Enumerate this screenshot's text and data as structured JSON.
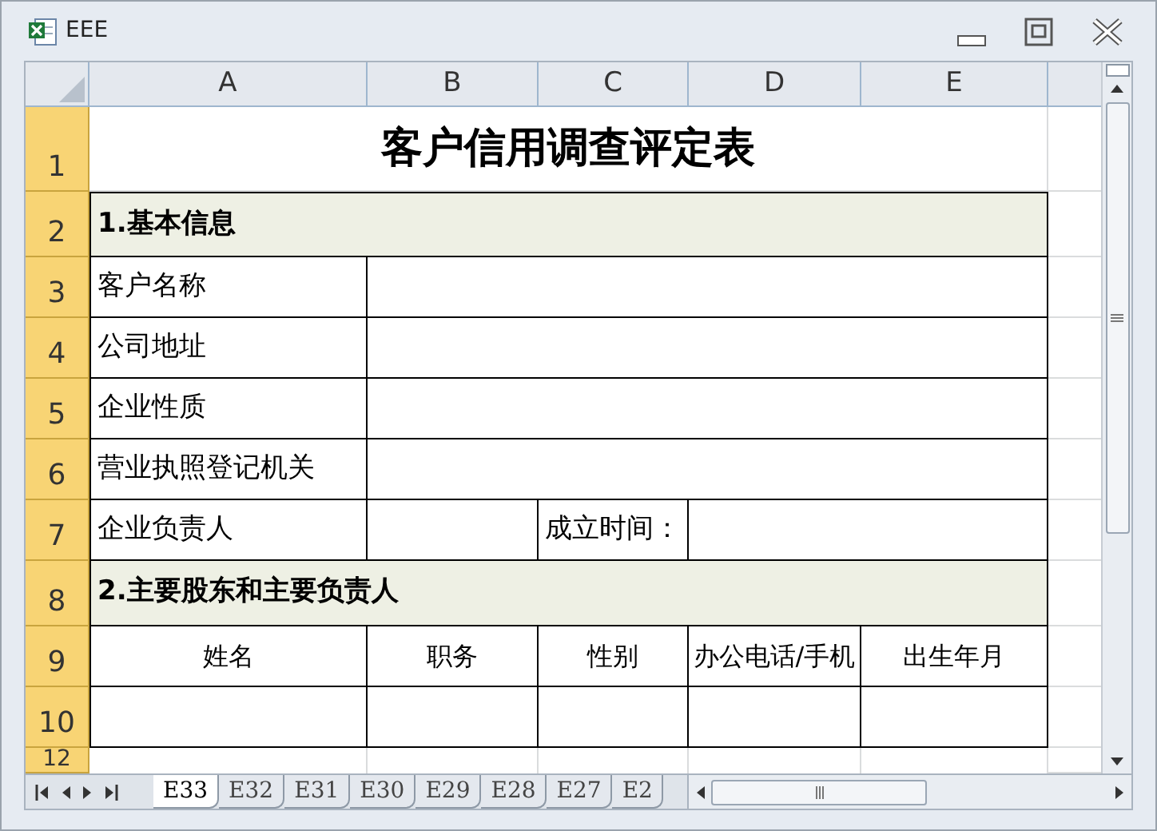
{
  "window": {
    "title": "EEE"
  },
  "columns": [
    "A",
    "B",
    "C",
    "D",
    "E"
  ],
  "rows": [
    {
      "number": "1",
      "kind": "title",
      "cells": [
        "客户信用调查评定表"
      ]
    },
    {
      "number": "2",
      "kind": "section",
      "cells": [
        "1.基本信息"
      ]
    },
    {
      "number": "3",
      "kind": "field",
      "cells": [
        "客户名称"
      ]
    },
    {
      "number": "4",
      "kind": "field",
      "cells": [
        "公司地址"
      ]
    },
    {
      "number": "5",
      "kind": "field",
      "cells": [
        "企业性质"
      ]
    },
    {
      "number": "6",
      "kind": "field",
      "cells": [
        "营业执照登记机关"
      ]
    },
    {
      "number": "7",
      "kind": "split",
      "cells": [
        "企业负责人",
        "成立时间："
      ]
    },
    {
      "number": "8",
      "kind": "section",
      "cells": [
        "2.主要股东和主要负责人"
      ]
    },
    {
      "number": "9",
      "kind": "header",
      "cells": [
        "姓名",
        "职务",
        "性别",
        "办公电话/手机",
        "出生年月"
      ]
    },
    {
      "number": "10",
      "kind": "blank",
      "cells": []
    },
    {
      "number": "12",
      "kind": "cut",
      "cells": []
    }
  ],
  "sheet_tabs": [
    {
      "label": "E33",
      "selected": true
    },
    {
      "label": "E32",
      "selected": false
    },
    {
      "label": "E31",
      "selected": false
    },
    {
      "label": "E30",
      "selected": false
    },
    {
      "label": "E29",
      "selected": false
    },
    {
      "label": "E28",
      "selected": false
    },
    {
      "label": "E27",
      "selected": false
    },
    {
      "label": "E2",
      "selected": false
    }
  ]
}
